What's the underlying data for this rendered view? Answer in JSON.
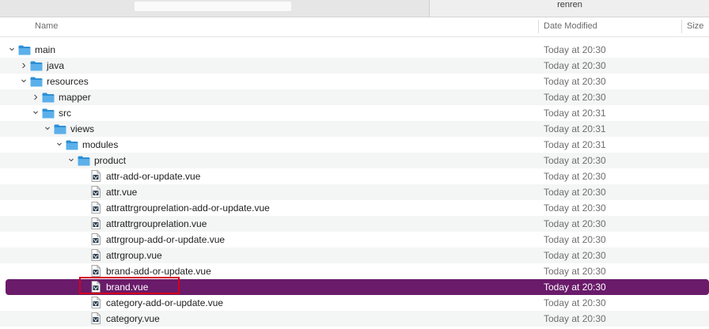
{
  "tabs": {
    "right_title": "renren"
  },
  "columns": {
    "name": "Name",
    "date_modified": "Date Modified",
    "size": "Size"
  },
  "rows": [
    {
      "name": "main",
      "date": "Today at 20:30",
      "type": "folder",
      "expanded": true
    },
    {
      "name": "java",
      "date": "Today at 20:30",
      "type": "folder",
      "expanded": false
    },
    {
      "name": "resources",
      "date": "Today at 20:30",
      "type": "folder",
      "expanded": true
    },
    {
      "name": "mapper",
      "date": "Today at 20:30",
      "type": "folder",
      "expanded": false
    },
    {
      "name": "src",
      "date": "Today at 20:31",
      "type": "folder",
      "expanded": true
    },
    {
      "name": "views",
      "date": "Today at 20:31",
      "type": "folder",
      "expanded": true
    },
    {
      "name": "modules",
      "date": "Today at 20:31",
      "type": "folder",
      "expanded": true
    },
    {
      "name": "product",
      "date": "Today at 20:30",
      "type": "folder",
      "expanded": true
    },
    {
      "name": "attr-add-or-update.vue",
      "date": "Today at 20:30",
      "type": "file"
    },
    {
      "name": "attr.vue",
      "date": "Today at 20:30",
      "type": "file"
    },
    {
      "name": "attrattrgrouprelation-add-or-update.vue",
      "date": "Today at 20:30",
      "type": "file"
    },
    {
      "name": "attrattrgrouprelation.vue",
      "date": "Today at 20:30",
      "type": "file"
    },
    {
      "name": "attrgroup-add-or-update.vue",
      "date": "Today at 20:30",
      "type": "file"
    },
    {
      "name": "attrgroup.vue",
      "date": "Today at 20:30",
      "type": "file"
    },
    {
      "name": "brand-add-or-update.vue",
      "date": "Today at 20:30",
      "type": "file"
    },
    {
      "name": "brand.vue",
      "date": "Today at 20:30",
      "type": "file",
      "selected": true
    },
    {
      "name": "category-add-or-update.vue",
      "date": "Today at 20:30",
      "type": "file"
    },
    {
      "name": "category.vue",
      "date": "Today at 20:30",
      "type": "file"
    }
  ],
  "colors": {
    "selection": "#6a1b6a",
    "folder": "#4fa3e0",
    "highlight_box": "#d6001c"
  },
  "icons": {
    "folder": "folder-icon",
    "file": "vue-file-icon",
    "expanded": "chevron-down-icon",
    "collapsed": "chevron-right-icon"
  }
}
